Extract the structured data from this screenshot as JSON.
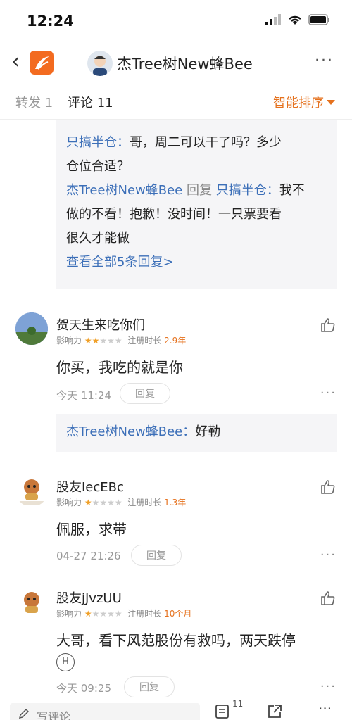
{
  "status": {
    "time": "12:24"
  },
  "header": {
    "title": "杰Tree树New蜂Bee",
    "more": "···"
  },
  "tabs": {
    "forward": "转发 1",
    "comments": "评论 11",
    "sort": "智能排序"
  },
  "thread1": {
    "line1_user": "只搞半仓：",
    "line1_text": "哥，周二可以干了吗？多少",
    "line1_text2": "仓位合适？",
    "reply_user": "杰Tree树New蜂Bee",
    "reply_word": "回复",
    "reply_to": "只搞半仓：",
    "reply_text": "我不",
    "reply_text2": "做的不看！抱歉！没时间！一只票要看",
    "reply_text3": "很久才能做",
    "view_all": "查看全部5条回复>"
  },
  "comments": [
    {
      "name": "贺天生来吃你们",
      "influence_label": "影响力",
      "stars_on": 2,
      "reg_label": "注册时长",
      "reg_value": "2.9年",
      "body": "你买，我吃的就是你",
      "time": "今天 11:24",
      "reply_btn": "回复",
      "sub_user": "杰Tree树New蜂Bee：",
      "sub_text": "好勒"
    },
    {
      "name": "股友IecEBc",
      "influence_label": "影响力",
      "stars_on": 1,
      "reg_label": "注册时长",
      "reg_value": "1.3年",
      "body": "佩服，求带",
      "time": "04-27 21:26",
      "reply_btn": "回复"
    },
    {
      "name": "股友jJvzUU",
      "influence_label": "影响力",
      "stars_on": 1,
      "reg_label": "注册时长",
      "reg_value": "10个月",
      "body": "大哥，看下风范股份有救吗，两天跌停",
      "time": "今天 09:25",
      "reply_btn": "回复"
    }
  ],
  "bottom": {
    "write": "写评论",
    "comment_count": "11"
  },
  "colors": {
    "accent": "#e5711d",
    "link": "#3c6fb8",
    "star": "#f0a028"
  }
}
